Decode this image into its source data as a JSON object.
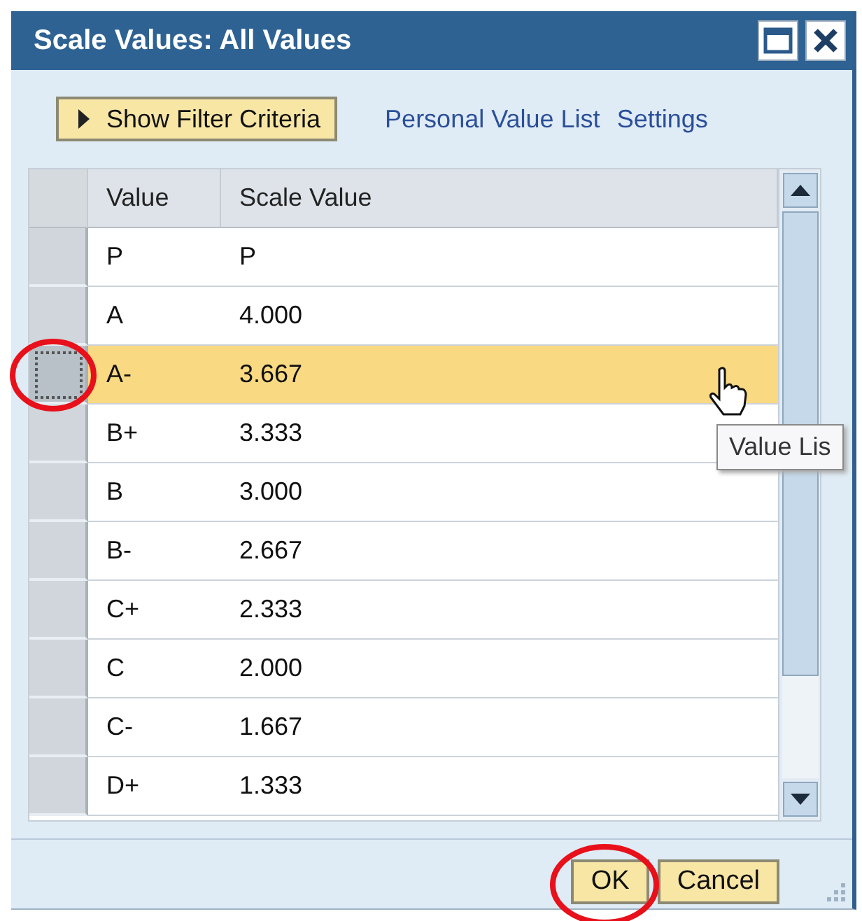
{
  "window": {
    "title": "Scale Values: All Values"
  },
  "toolbar": {
    "filter_button": "Show Filter Criteria",
    "links": [
      "Personal Value List",
      "Settings"
    ]
  },
  "table": {
    "columns": [
      "Value",
      "Scale Value"
    ],
    "rows": [
      {
        "value": "P",
        "scale_value": "P",
        "selected": false
      },
      {
        "value": "A",
        "scale_value": "4.000",
        "selected": false
      },
      {
        "value": "A-",
        "scale_value": "3.667",
        "selected": true
      },
      {
        "value": "B+",
        "scale_value": "3.333",
        "selected": false
      },
      {
        "value": "B",
        "scale_value": "3.000",
        "selected": false
      },
      {
        "value": "B-",
        "scale_value": "2.667",
        "selected": false
      },
      {
        "value": "C+",
        "scale_value": "2.333",
        "selected": false
      },
      {
        "value": "C",
        "scale_value": "2.000",
        "selected": false
      },
      {
        "value": "C-",
        "scale_value": "1.667",
        "selected": false
      },
      {
        "value": "D+",
        "scale_value": "1.333",
        "selected": false
      }
    ]
  },
  "tooltip": "Value Lis",
  "buttons": [
    "OK",
    "Cancel"
  ]
}
